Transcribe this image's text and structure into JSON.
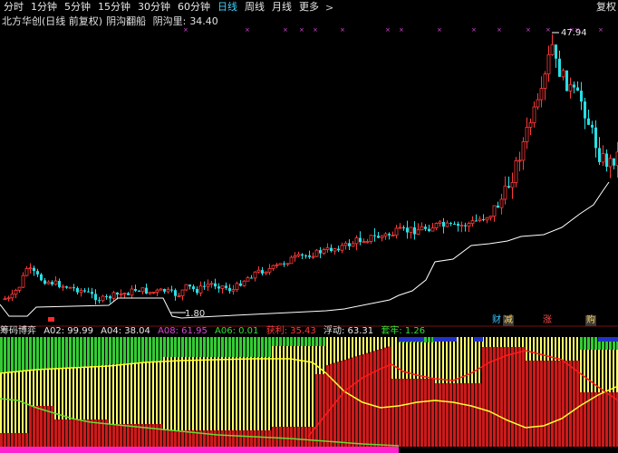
{
  "toolbar": {
    "tabs": [
      "分时",
      "1分钟",
      "5分钟",
      "15分钟",
      "30分钟",
      "60分钟",
      "日线",
      "周线",
      "月线",
      "更多"
    ],
    "active_index": 6,
    "more_arrow": ">",
    "restore_label": "复权"
  },
  "title": {
    "stock": "北方华创(日线 前复权)",
    "indicator": "阴沟翻船",
    "indicator2_label": "阴沟里:",
    "indicator2_value": "34.40"
  },
  "main_chart": {
    "high_label": "47.94",
    "low_label": "1.80",
    "colors": {
      "up": "#ff3a3a",
      "down": "#26e0e6",
      "line": "#ffffff",
      "x_mark": "#d94adf"
    }
  },
  "markers": {
    "cai": "财",
    "jian": "减",
    "zhang": "涨",
    "gou": "购"
  },
  "sub_header": {
    "name": "筹码博弈",
    "a02": "A02: 99.99",
    "a04": "A04: 38.04",
    "a08": "A08: 61.95",
    "a06": "A06: 0.01",
    "profit": "获利: 35.43",
    "float": "浮动: 63.31",
    "trapped": "套牢: 1.26"
  }
}
